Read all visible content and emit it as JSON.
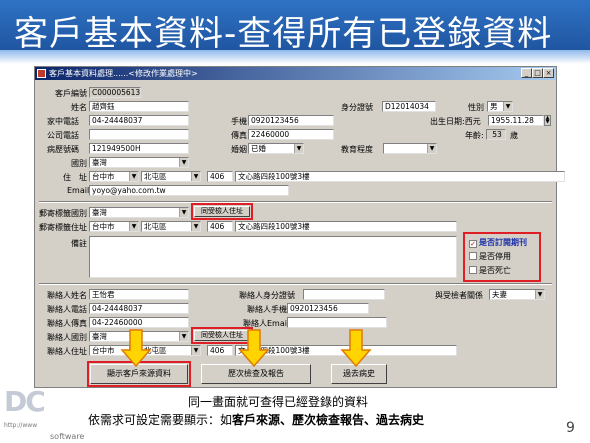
{
  "slide": {
    "title": "客戶基本資料-查得所有已登錄資料",
    "caption_line1": "同一畫面就可查得已經登錄的資料",
    "caption_line2_prefix": "依需求可設定需要顯示：如",
    "caption_line2_bold": "客戶來源、歷次檢查報告、過去病史",
    "page_number": "9",
    "logo_text": "DC",
    "logo_url": "http://www",
    "logo_software": "software"
  },
  "window": {
    "title": "客戶基本資料處理......<修改作業處理中>",
    "min": "_",
    "max": "□",
    "close": "×"
  },
  "form": {
    "customer_no_label": "客戶編號",
    "customer_no": "C000005613",
    "name_label": "姓名",
    "name": "趙齊鈺",
    "id_label": "身分證號",
    "id": "D12014034",
    "gender_label": "性別",
    "gender": "男",
    "home_phone_label": "家中電話",
    "home_phone": "04-24448037",
    "mobile_label": "手機",
    "mobile": "0920123456",
    "birth_label": "出生日期:西元",
    "birth": "1955.11.28",
    "company_phone_label": "公司電話",
    "company_phone": "",
    "fax_label": "傳真",
    "fax": "22460000",
    "age_label": "年齡:",
    "age": "53",
    "age_unit": "歲",
    "medical_no_label": "病歷號碼",
    "medical_no": "121949500H",
    "marriage_label": "婚姻",
    "marriage": "已婚",
    "education_label": "教育程度",
    "education": "",
    "country_label": "國別",
    "country": "臺灣",
    "address_label": "住　址",
    "city": "台中市",
    "district": "北屯區",
    "zip": "406",
    "address": "文心路四段100號3樓",
    "email_label": "Email",
    "email": "yoyo@yaho.com.tw",
    "mail_country_label": "郵寄標籤國別",
    "mail_country": "臺灣",
    "same_address_btn": "同受檢人住址",
    "mail_address_label": "郵寄標籤住址",
    "mail_city": "台中市",
    "mail_district": "北屯區",
    "mail_zip": "406",
    "mail_address": "文心路四段100號3樓",
    "remark_label": "備註",
    "chk_subscribe": "是否訂閱期刊",
    "chk_suspended": "是否停用",
    "chk_deceased": "是否死亡",
    "contact_name_label": "聯絡人姓名",
    "contact_name": "王怡君",
    "contact_id_label": "聯絡人身分證號",
    "contact_id": "",
    "relation_label": "與受檢者關係",
    "relation": "夫妻",
    "contact_phone_label": "聯絡人電話",
    "contact_phone": "04-24448037",
    "contact_mobile_label": "聯絡人手機",
    "contact_mobile": "0920123456",
    "contact_fax_label": "聯絡人傳真",
    "contact_fax": "04-22460000",
    "contact_email_label": "聯絡人Email",
    "contact_email": "",
    "contact_country_label": "聯絡人國別",
    "contact_country": "臺灣",
    "contact_same_btn": "同受檢人住址",
    "contact_address_label": "聯絡人住址",
    "contact_city": "台中市",
    "contact_district": "北屯區",
    "contact_zip": "406",
    "contact_address": "文心路四段100號3樓"
  },
  "buttons": {
    "source": "顯示客戶來源資料",
    "reports": "歷次檢查及報告",
    "history": "過去病史"
  },
  "colors": {
    "title_bar": "#1b4f99",
    "highlight": "#e01e25",
    "arrow_fill": "#ffd400",
    "arrow_stroke": "#e07a00"
  }
}
